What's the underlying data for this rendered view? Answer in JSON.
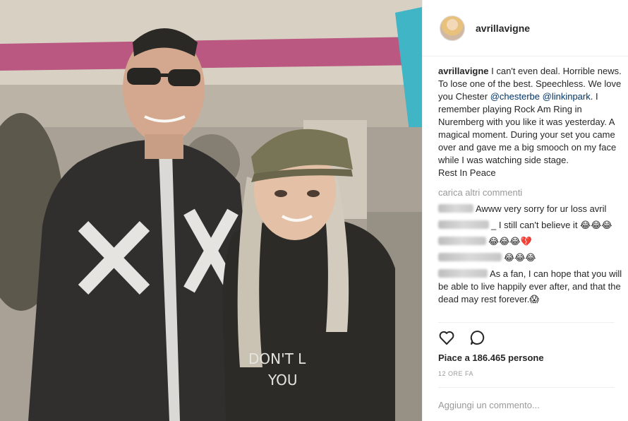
{
  "post": {
    "username": "avrillavigne",
    "caption": {
      "user": "avrillavigne",
      "text1": " I can't even deal. Horrible news. To lose one of the best. Speechless. We love you Chester ",
      "mention1": "@chesterbe",
      "space": " ",
      "mention2": "@linkinpark",
      "text2": ". I remember playing Rock Am Ring in Nuremberg with you like it was yesterday. A magical moment. During your set you came over and gave me a big smooch on my face while I was watching side stage.",
      "text3": "Rest In Peace"
    },
    "load_more": "carica altri commenti",
    "comments": [
      {
        "text": "Awww very sorry for ur loss avril"
      },
      {
        "text": "_ I still can't believe it 😂😂😂"
      },
      {
        "text": "😂😂😂💔"
      },
      {
        "text": "😂😂😂"
      },
      {
        "text": "As a fan, I can hope that you will be able to live happily ever after, and that the dead may rest forever.😱"
      }
    ],
    "likes": "Piace a 186.465 persone",
    "time": "12 ORE FA",
    "add_comment_placeholder": "Aggiungi un commento..."
  },
  "photo": {
    "shirt_text_line1": "DON'T L",
    "shirt_text_line2": "YOU"
  },
  "colors": {
    "text": "#262626",
    "muted": "#999999",
    "mention": "#003569",
    "border": "#efefef"
  },
  "icons": {
    "like": "heart-outline-icon",
    "comment": "speech-bubble-icon"
  }
}
